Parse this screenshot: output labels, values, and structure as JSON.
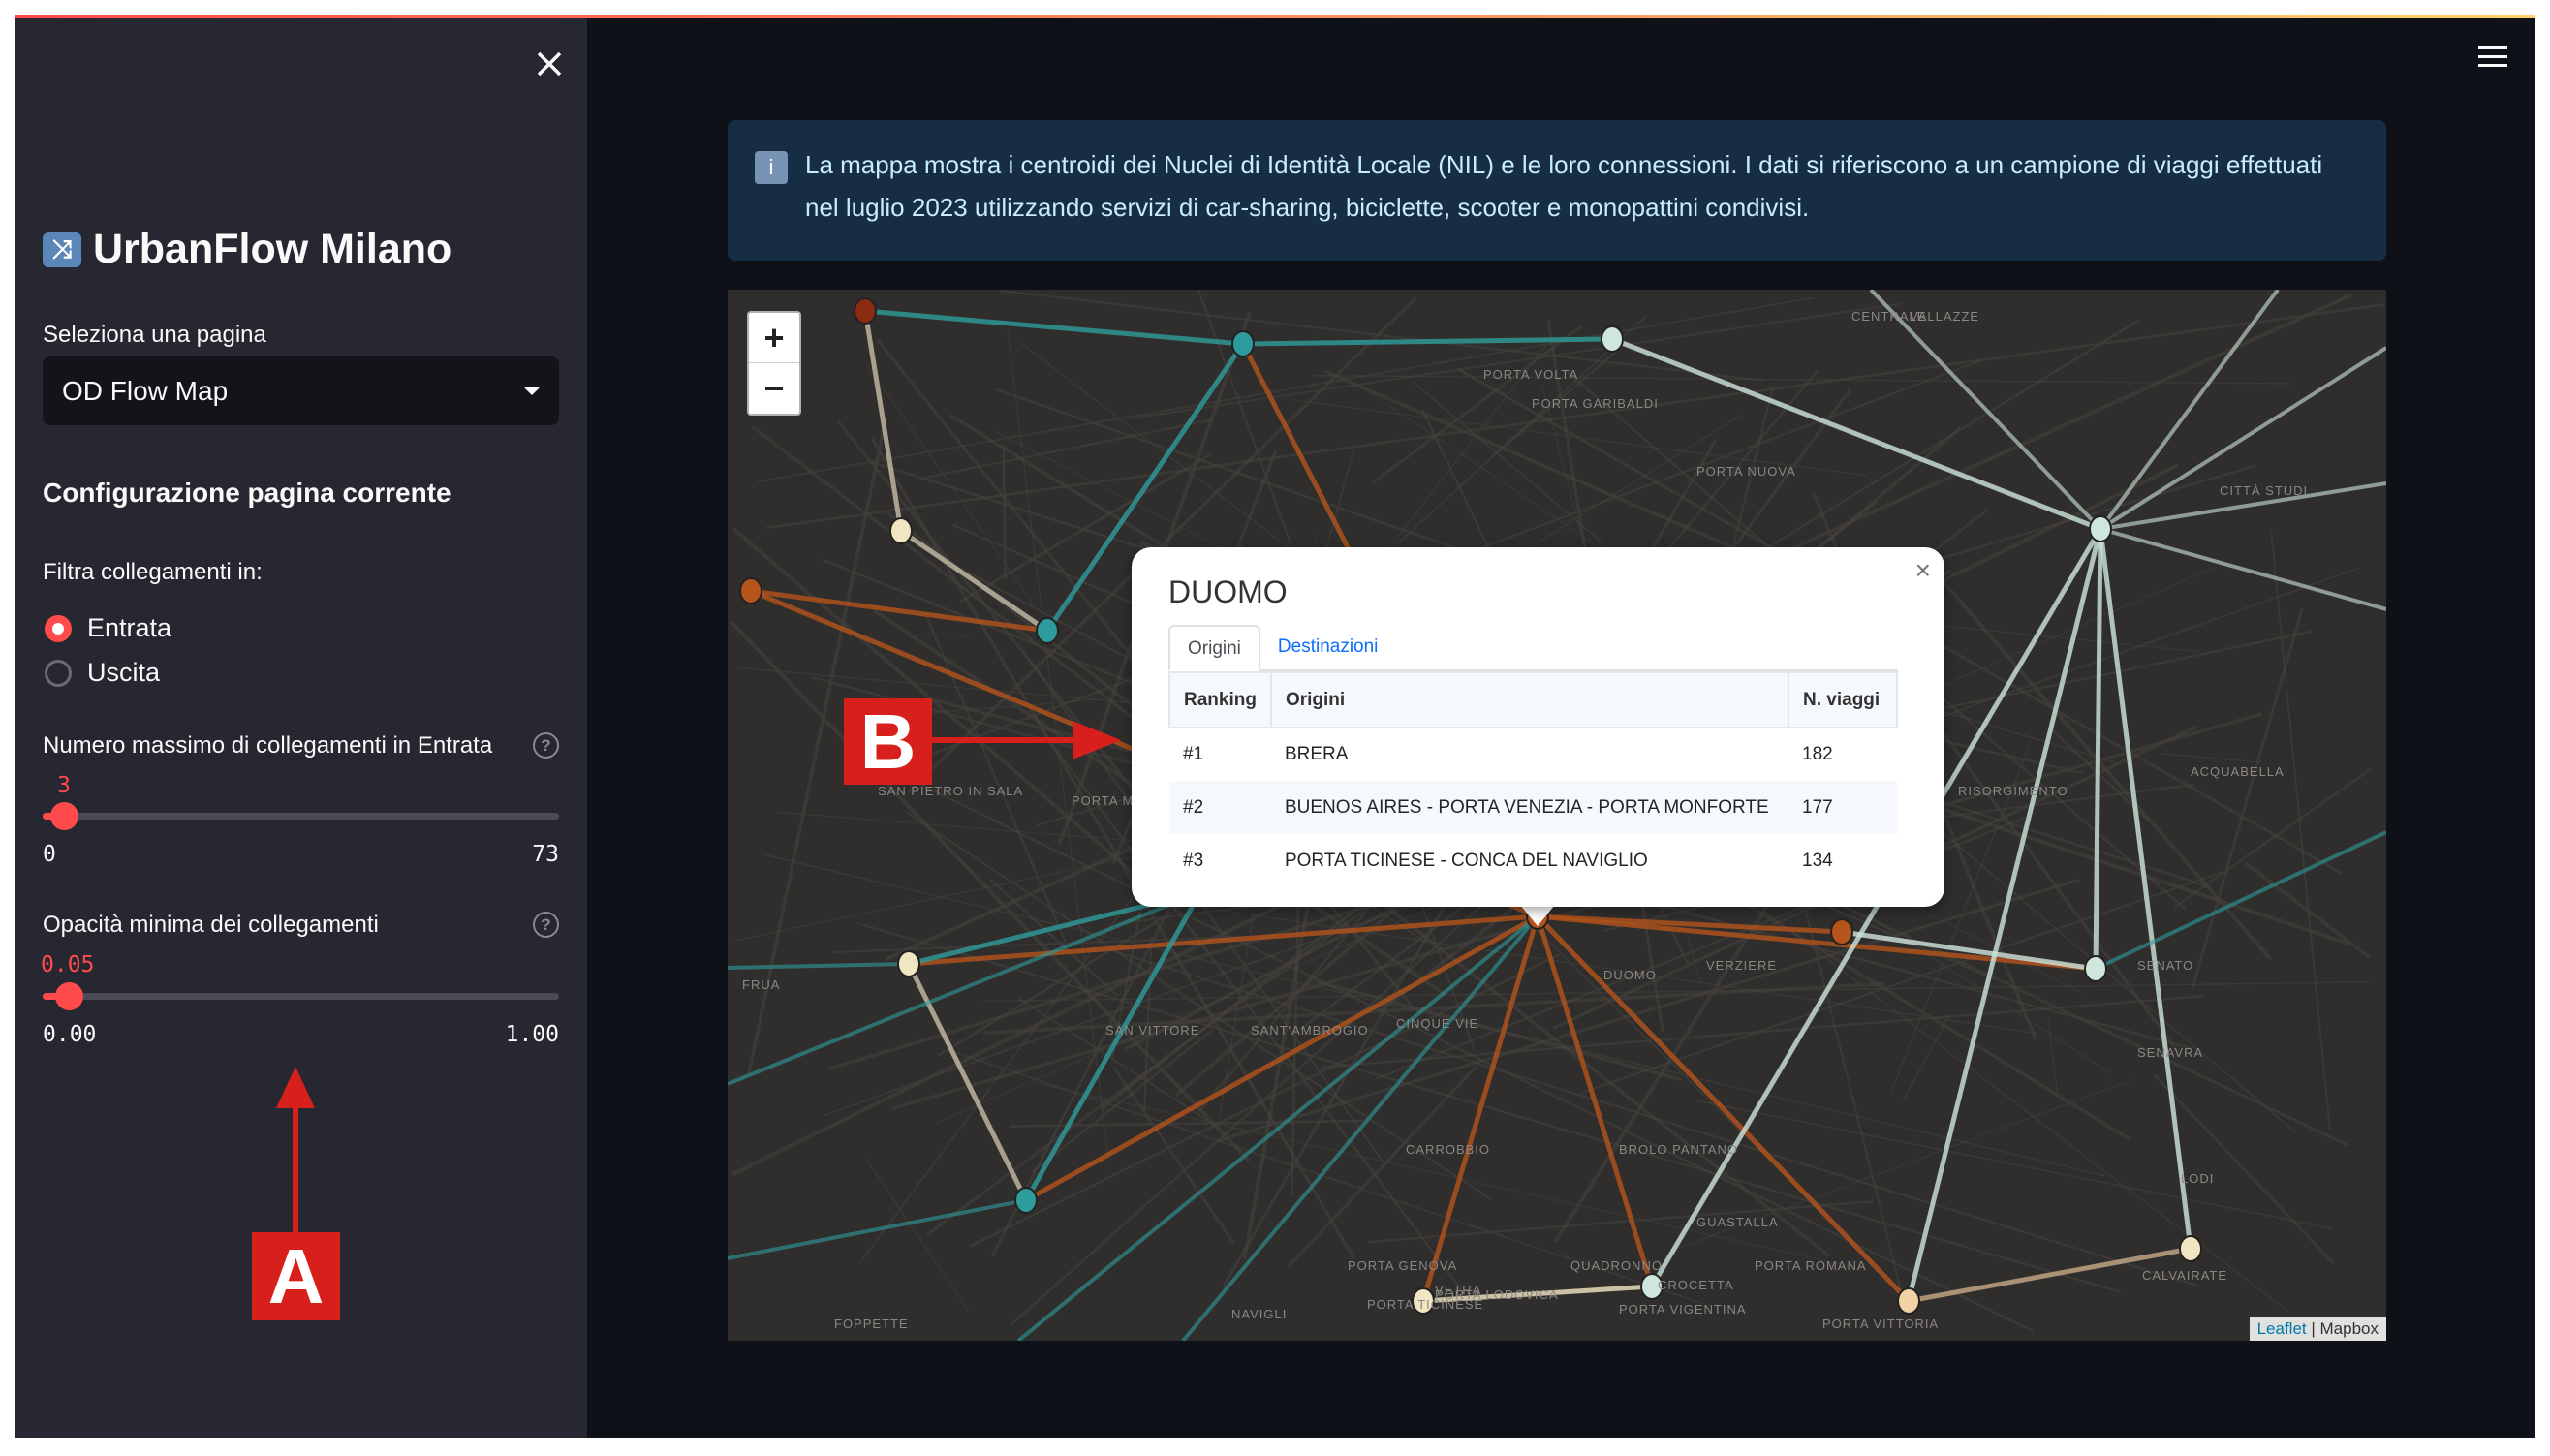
{
  "sidebar": {
    "title": "UrbanFlow Milano",
    "title_icon": "shuffle-icon",
    "page_select_label": "Seleziona una pagina",
    "page_select_value": "OD Flow Map",
    "config_heading": "Configurazione pagina corrente",
    "filter_label": "Filtra collegamenti in:",
    "filter_options": [
      {
        "label": "Entrata",
        "selected": true
      },
      {
        "label": "Uscita",
        "selected": false
      }
    ],
    "max_links": {
      "label": "Numero massimo di collegamenti in Entrata",
      "value": "3",
      "min": "0",
      "max": "73",
      "fraction": 0.041
    },
    "min_opacity": {
      "label": "Opacità minima dei collegamenti",
      "value": "0.05",
      "min": "0.00",
      "max": "1.00",
      "fraction": 0.05
    }
  },
  "info": {
    "text": "La mappa mostra i centroidi dei Nuclei di Identità Locale (NIL) e le loro connessioni. I dati si riferiscono a un campione di viaggi effettuati nel luglio 2023 utilizzando servizi di car-sharing, biciclette, scooter e monopattini condivisi."
  },
  "map": {
    "zoom_in": "+",
    "zoom_out": "−",
    "labels": [
      "PORTA GARIBALDI",
      "PORTA VOLTA",
      "PORTA NUOVA",
      "CENTRALE",
      "DUOMO",
      "CINQUE VIE",
      "SAN VITTORE",
      "SANT'AMBROGIO",
      "CARROBBIO",
      "BROLO PANTANO",
      "GUASTALLA",
      "PORTA GENOVA",
      "VETRA",
      "CROCETTA",
      "QUADRONNO",
      "PORTA TICINESE",
      "PORTA LODOVICA",
      "PORTA VIGENTINA",
      "PORTA ROMANA",
      "PORTA VITTORIA",
      "SENATO",
      "ACQUABELLA",
      "CALVAIRATE",
      "SENAVRA",
      "LODI",
      "FRUA",
      "SAN PIETRO IN SALA",
      "PORTA MAGENTA",
      "VALLAZZE",
      "CITTÀ STUDI",
      "RISORGIMENTO",
      "NAVIGLI",
      "FOPPETTE",
      "VERZIERE"
    ],
    "attribution_leaflet": "Leaflet",
    "attribution_mapbox": "Mapbox",
    "colors": {
      "orange": "#b5541b",
      "teal": "#2e9c9c",
      "mint": "#cfe6dc",
      "cream": "#f2e6c2"
    }
  },
  "popup": {
    "title": "DUOMO",
    "tabs": [
      "Origini",
      "Destinazioni"
    ],
    "active_tab": "Origini",
    "columns": [
      "Ranking",
      "Origini",
      "N. viaggi"
    ],
    "rows": [
      [
        "#1",
        "BRERA",
        "182"
      ],
      [
        "#2",
        "BUENOS AIRES - PORTA VENEZIA - PORTA MONFORTE",
        "177"
      ],
      [
        "#3",
        "PORTA TICINESE - CONCA DEL NAVIGLIO",
        "134"
      ]
    ]
  },
  "annotations": {
    "a": "A",
    "b": "B"
  }
}
